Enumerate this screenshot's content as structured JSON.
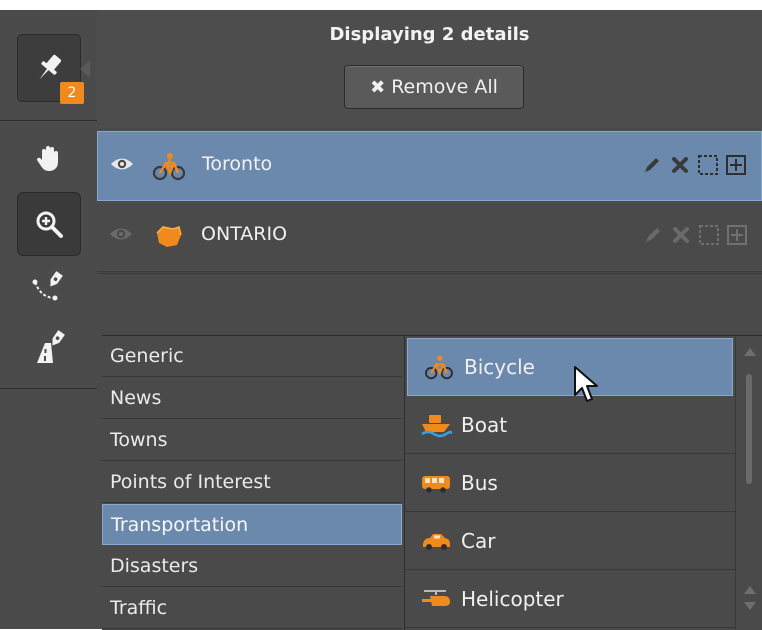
{
  "header": {
    "title": "Displaying 2 details",
    "remove_all_label": "Remove All"
  },
  "toolbar": {
    "badge_count": "2",
    "tools": [
      "pin-icon",
      "hand-icon",
      "zoom-icon",
      "path-pen-icon",
      "road-pen-icon"
    ]
  },
  "details": [
    {
      "label": "Toronto",
      "icon": "bicycle-icon",
      "visible": true,
      "selected": true
    },
    {
      "label": "ONTARIO",
      "icon": "region-shape-icon",
      "visible": true,
      "selected": false
    }
  ],
  "categories": [
    {
      "label": "Generic"
    },
    {
      "label": "News"
    },
    {
      "label": "Towns"
    },
    {
      "label": "Points of Interest"
    },
    {
      "label": "Transportation",
      "selected": true
    },
    {
      "label": "Disasters"
    },
    {
      "label": "Traffic"
    }
  ],
  "subtypes": [
    {
      "label": "Bicycle",
      "icon": "bicycle-icon",
      "selected": true
    },
    {
      "label": "Boat",
      "icon": "boat-icon"
    },
    {
      "label": "Bus",
      "icon": "bus-icon"
    },
    {
      "label": "Car",
      "icon": "car-icon"
    },
    {
      "label": "Helicopter",
      "icon": "helicopter-icon"
    }
  ],
  "colors": {
    "accent_orange": "#f08a1c",
    "selection_blue": "#6a89ad",
    "panel_gray": "#4a4a4a"
  }
}
